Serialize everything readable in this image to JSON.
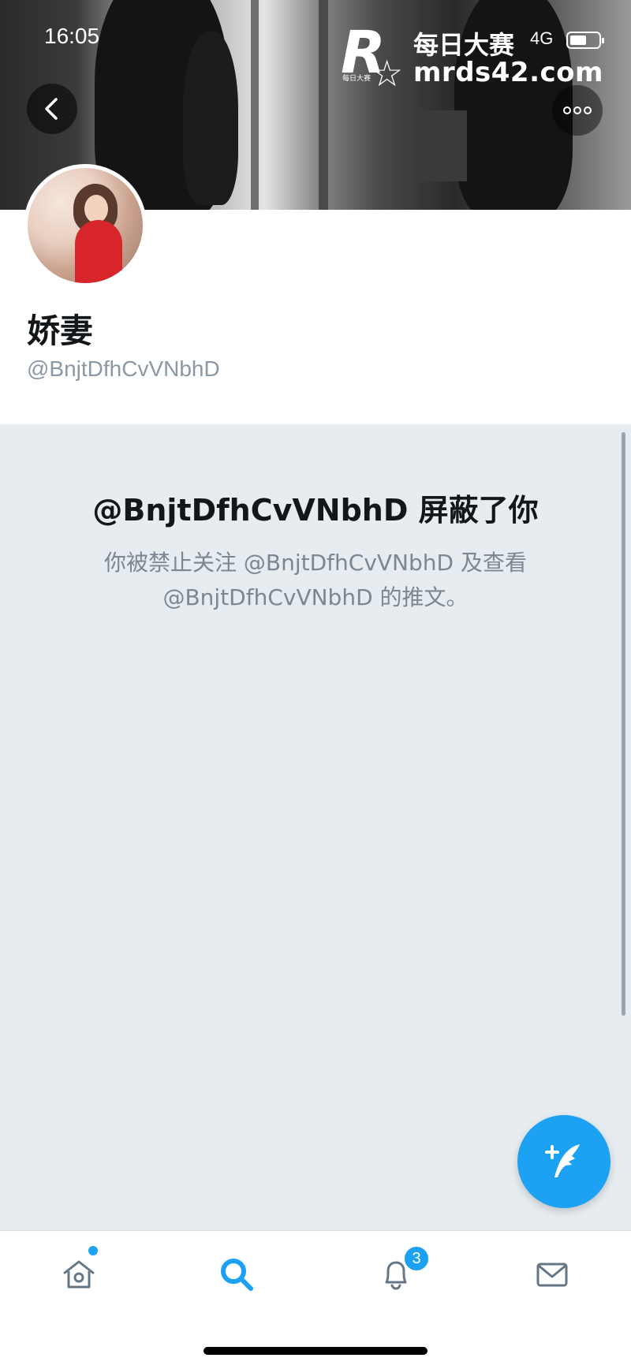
{
  "status_bar": {
    "time": "16:05",
    "network": "4G"
  },
  "watermark": {
    "logo_letter": "R",
    "logo_small": "每日大赛",
    "title": "每日大赛",
    "url": "mrds42.com"
  },
  "profile": {
    "name": "娇妻",
    "handle": "@BnjtDfhCvVNbhD"
  },
  "blocked_notice": {
    "title": "@BnjtDfhCvVNbhD 屏蔽了你",
    "line1": "你被禁止关注 @BnjtDfhCvVNbhD 及查看",
    "line2": "@BnjtDfhCvVNbhD 的推文。"
  },
  "tabs": [
    {
      "icon": "home-icon",
      "has_dot": true
    },
    {
      "icon": "search-icon",
      "active": true
    },
    {
      "icon": "notifications-icon",
      "badge": "3"
    },
    {
      "icon": "messages-icon"
    }
  ],
  "colors": {
    "accent": "#1da1f2",
    "panel_bg": "#e6ecf0",
    "text_primary": "#14171a",
    "text_secondary": "#8b98a5"
  }
}
